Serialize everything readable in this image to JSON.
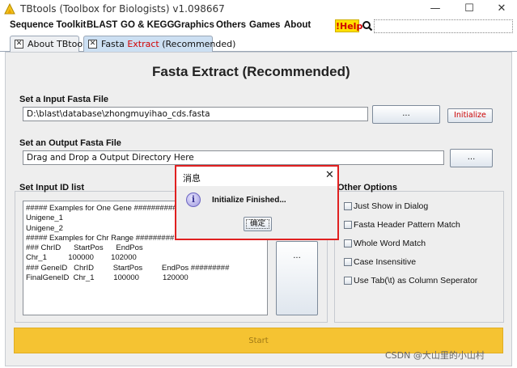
{
  "window": {
    "title": "TBtools (Toolbox for Biologists) v1.098667",
    "controls": {
      "minimize": "—",
      "maximize": "☐",
      "close": "✕"
    }
  },
  "menubar": {
    "items": [
      "Sequence Toolkit",
      "BLAST",
      "GO & KEGG",
      "Graphics",
      "Others",
      "Games",
      "About"
    ],
    "help_label": "!Help",
    "search_value": ""
  },
  "tabs": [
    {
      "close": "✕",
      "label": "About TBtools",
      "active": false
    },
    {
      "close": "✕",
      "label_pre": "Fasta ",
      "label_highlight": "Extract",
      "label_post": " (Recommended)",
      "active": true
    }
  ],
  "main": {
    "title": "Fasta Extract (Recommended)",
    "input_fasta": {
      "label": "Set a Input Fasta File",
      "value": "D:\\blast\\database\\zhongmuyihao_cds.fasta",
      "browse_label": "...",
      "initialize_label": "Initialize"
    },
    "output_fasta": {
      "label": "Set an Output Fasta File",
      "value": "Drag and Drop a Output Directory Here",
      "browse_label": "..."
    },
    "id_list": {
      "label": "Set Input ID list",
      "lines": [
        "##### Examples for One Gene ###########",
        "Unigene_1",
        "Unigene_2",
        "##### Examples for Chr Range #########",
        "### ChrID      StartPos      EndPos",
        "Chr_1          100000        102000",
        "### GeneID   ChrID         StartPos         EndPos #########",
        "FinalGeneID  Chr_1         100000           120000"
      ],
      "browse_label": "..."
    },
    "other_options": {
      "label": "Other Options",
      "options": [
        {
          "label": "Just Show in Dialog",
          "checked": false
        },
        {
          "label": "Fasta Header Pattern Match",
          "checked": false
        },
        {
          "label": "Whole Word Match",
          "checked": false
        },
        {
          "label": "Case Insensitive",
          "checked": false
        },
        {
          "label": "Use Tab(\\t) as Column Seperator",
          "checked": false
        }
      ]
    },
    "start_label": "Start"
  },
  "dialog": {
    "title": "消息",
    "close": "✕",
    "icon": "info-icon",
    "icon_glyph": "i",
    "message": "Initialize Finished...",
    "ok_label": "确定"
  },
  "watermark": "CSDN @大山里的小山村",
  "colors": {
    "start_button": "#f5c332",
    "help_bg": "#ffe000",
    "highlight_red": "#d00000",
    "dialog_border": "#e02020"
  }
}
